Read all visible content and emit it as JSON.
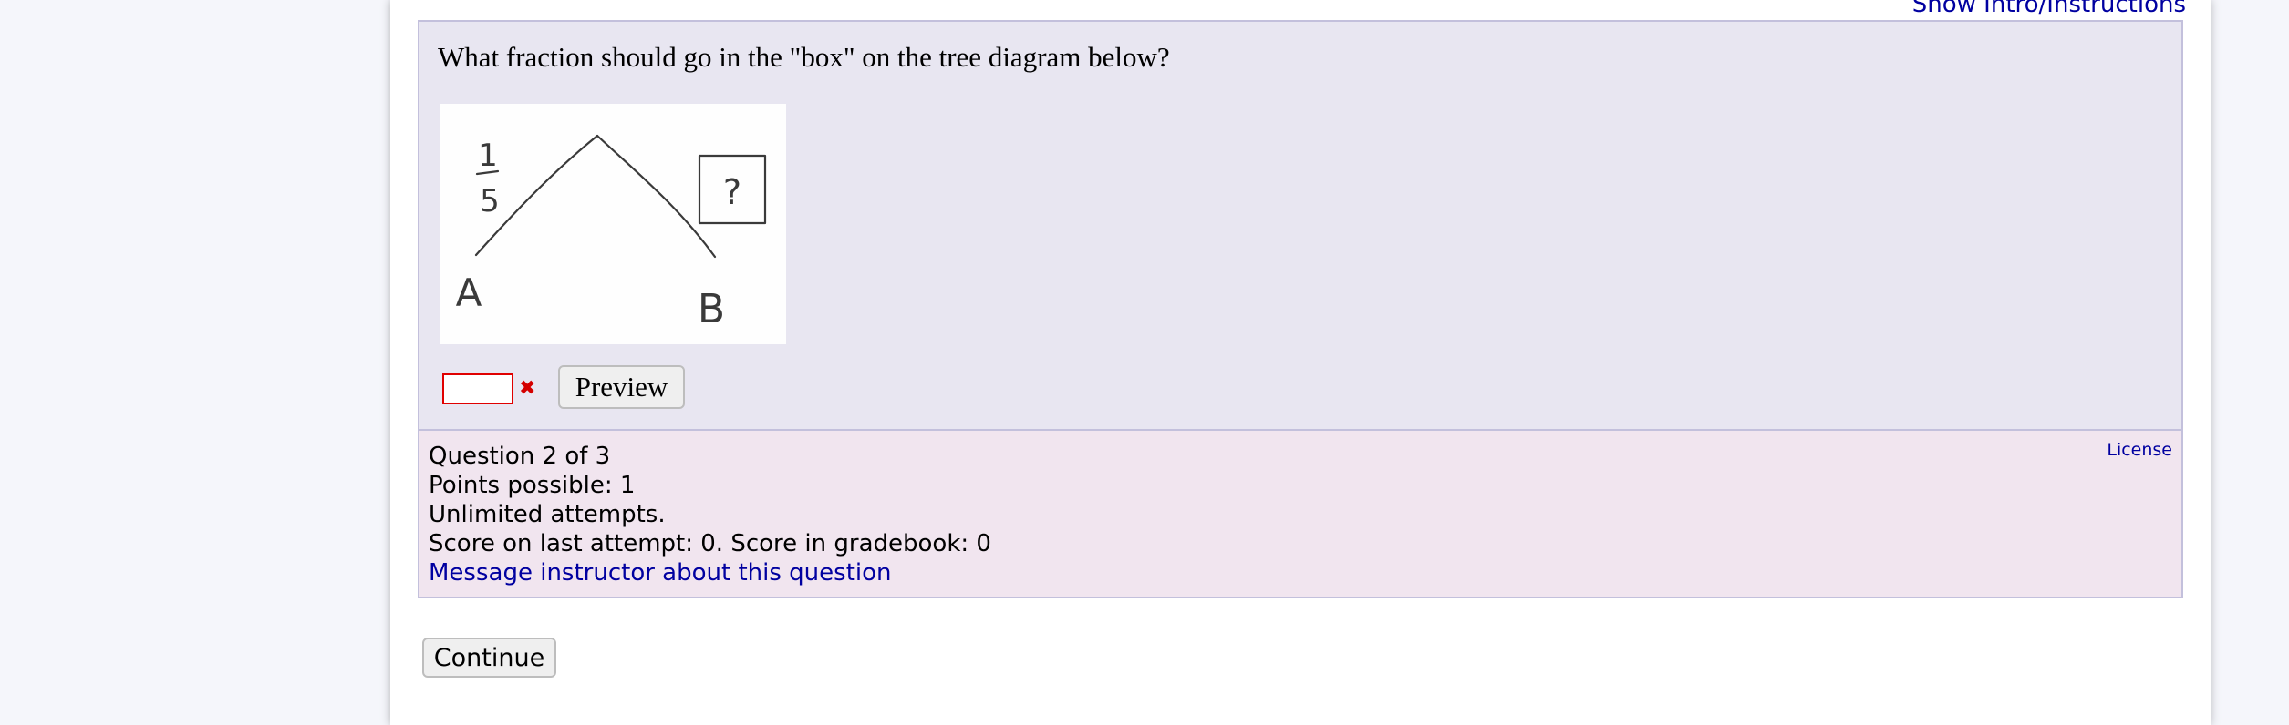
{
  "header": {
    "intro_link": "Show Intro/Instructions"
  },
  "question": {
    "prompt": "What fraction should go in the \"box\" on the tree diagram below?",
    "figure": {
      "branch_label_fraction_numerator": "1",
      "branch_label_fraction_denominator": "5",
      "box_label": "?",
      "left_node": "A",
      "right_node": "B"
    },
    "answer": {
      "value": "",
      "status": "incorrect",
      "status_color": "#d40000"
    },
    "preview_label": "Preview"
  },
  "info": {
    "question_number": "Question 2 of 3",
    "points": "Points possible: 1",
    "attempts": "Unlimited attempts.",
    "score": "Score on last attempt: 0. Score in gradebook: 0",
    "message_link": "Message instructor about this question",
    "license_link": "License"
  },
  "continue_label": "Continue",
  "colors": {
    "question_bg": "#e8e6f1",
    "info_bg": "#f1e5ef",
    "link": "#0000a0",
    "error_border": "#e00000"
  }
}
